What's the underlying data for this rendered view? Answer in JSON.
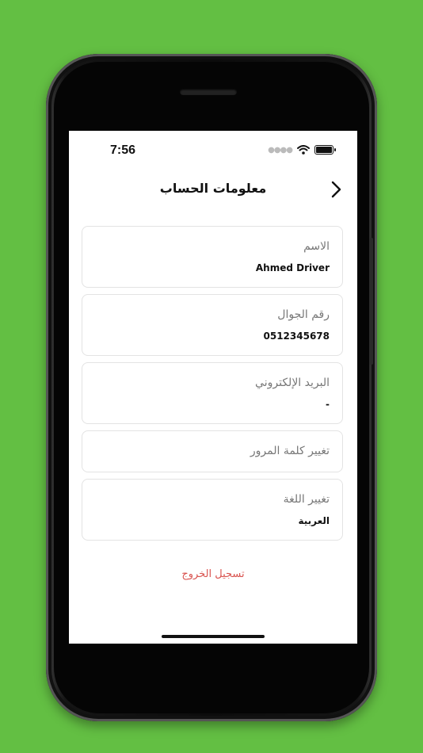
{
  "status": {
    "time": "7:56"
  },
  "header": {
    "title": "معلومات الحساب"
  },
  "fields": [
    {
      "label": "الاسم",
      "value": "Ahmed Driver"
    },
    {
      "label": "رقم الجوال",
      "value": "0512345678"
    },
    {
      "label": "البريد الإلكتروني",
      "value": "-"
    },
    {
      "label": "تغيير كلمة المرور"
    },
    {
      "label": "تغيير اللغة",
      "value": "العربية"
    }
  ],
  "logout": {
    "label": "تسجيل الخروج"
  },
  "colors": {
    "background": "#63bf43",
    "logout": "#d9534f"
  },
  "icons": {
    "back": "chevron-right-icon",
    "wifi": "wifi-icon",
    "battery": "battery-icon"
  }
}
